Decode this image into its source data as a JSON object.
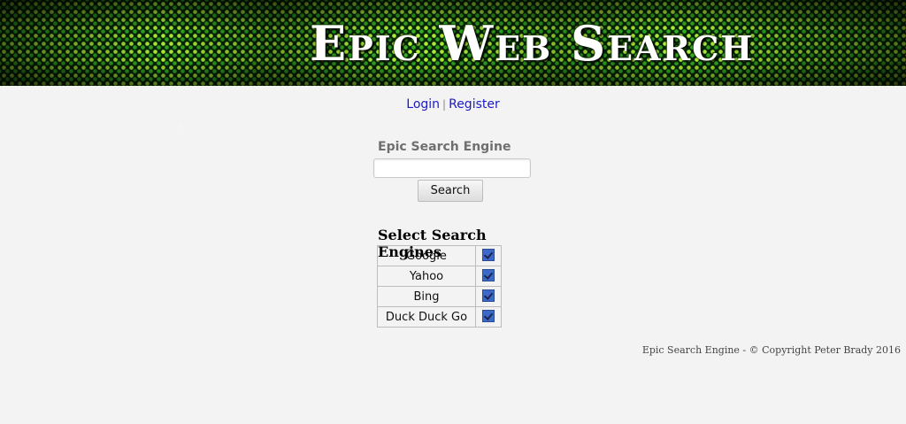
{
  "banner": {
    "title": "Epic Web Search"
  },
  "auth": {
    "login_label": "Login",
    "separator": "|",
    "register_label": "Register"
  },
  "search": {
    "label": "Epic Search Engine",
    "input_value": "",
    "button_label": "Search"
  },
  "engines": {
    "title": "Select Search Engines",
    "items": [
      {
        "name": "Google",
        "checked": true
      },
      {
        "name": "Yahoo",
        "checked": true
      },
      {
        "name": "Bing",
        "checked": true
      },
      {
        "name": "Duck Duck Go",
        "checked": true
      }
    ]
  },
  "footer": {
    "text": "Epic Search Engine - © Copyright Peter Brady 2016"
  },
  "colors": {
    "link": "#1a1ac8",
    "banner_green": "#062806",
    "checkbox": "#3c69c8"
  }
}
